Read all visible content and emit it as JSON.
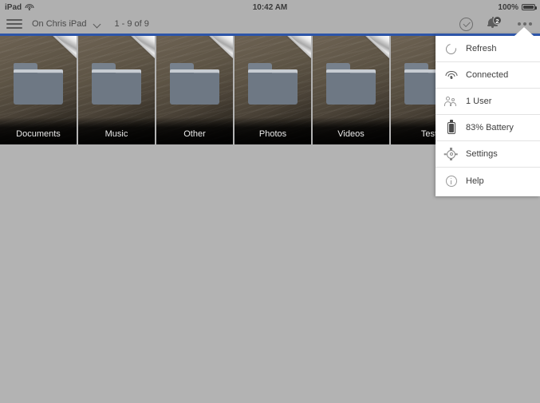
{
  "status_bar": {
    "device_label": "iPad",
    "wifi_icon": "wifi-icon",
    "time": "10:42 AM",
    "battery_percent": "100%",
    "battery_icon": "battery-full-icon"
  },
  "toolbar": {
    "menu_icon": "hamburger-menu-icon",
    "location": "On Chris iPad",
    "location_chevron_icon": "chevron-down-icon",
    "item_range": "1 - 9 of 9",
    "select_icon": "check-circle-icon",
    "notifications_icon": "bell-icon",
    "notifications_badge": "2",
    "overflow_icon": "more-options-icon"
  },
  "colors": {
    "accent_blue": "#2d55a8",
    "chrome_gray": "#b0b0b0",
    "canvas_gray": "#b3b3b3",
    "folder_blue_gray": "#6e7884"
  },
  "files": {
    "items": [
      {
        "name": "Documents",
        "type": "folder"
      },
      {
        "name": "Music",
        "type": "folder"
      },
      {
        "name": "Other",
        "type": "folder"
      },
      {
        "name": "Photos",
        "type": "folder"
      },
      {
        "name": "Videos",
        "type": "folder"
      },
      {
        "name": "Test",
        "type": "folder"
      }
    ]
  },
  "dropdown": {
    "items": [
      {
        "label": "Refresh",
        "icon": "refresh-icon"
      },
      {
        "label": "Connected",
        "icon": "wifi-icon"
      },
      {
        "label": "1 User",
        "icon": "users-icon"
      },
      {
        "label": "83% Battery",
        "icon": "battery-icon"
      },
      {
        "label": "Settings",
        "icon": "gear-icon"
      },
      {
        "label": "Help",
        "icon": "info-icon"
      }
    ]
  }
}
